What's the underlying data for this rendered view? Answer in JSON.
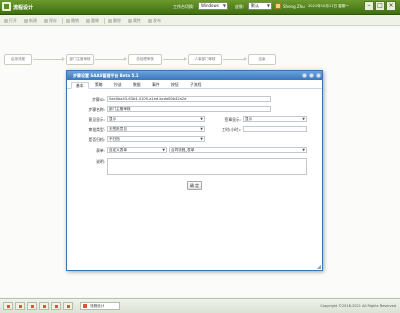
{
  "topbar": {
    "app_title": "流程设计",
    "work_switch_label": "工作台切换:",
    "work_switch_value": "Windows",
    "skin_label": "皮肤:",
    "skin_value": "默认",
    "user_name": "Sheng Zhu",
    "datetime": "2021年10月11日 星期一",
    "colors": {
      "bar_top": "#6c9a2c",
      "bar_bottom": "#3f6e12"
    }
  },
  "toolbar": {
    "items": [
      {
        "label": "打开",
        "icon": "folder-open-icon"
      },
      {
        "label": "新建",
        "icon": "new-file-icon"
      },
      {
        "label": "保存",
        "icon": "save-icon"
      },
      {
        "label": "撤销",
        "icon": "undo-icon"
      },
      {
        "label": "重做",
        "icon": "redo-icon"
      },
      {
        "label": "删除",
        "icon": "delete-icon"
      },
      {
        "label": "属性",
        "icon": "properties-icon"
      },
      {
        "label": "发布",
        "icon": "publish-icon"
      }
    ]
  },
  "flow": {
    "nodes": [
      {
        "label": "启用流程"
      },
      {
        "label": "部门主管审核"
      },
      {
        "label": "总经理审核"
      },
      {
        "label": "人事部门审核"
      },
      {
        "label": "结束"
      }
    ]
  },
  "modal": {
    "title": "步骤设置 SAAS管理平台 Beta 5.1",
    "tabs": [
      "基本",
      "策略",
      "抄送",
      "数据",
      "事件",
      "按钮",
      "子流程"
    ],
    "active_tab": "基本",
    "fields": {
      "step_id_label": "步骤ID:",
      "step_id_value": "0ae0ba43-63b4-4109-a1ed-bcda80b42a2d",
      "step_name_label": "步骤名称:",
      "step_name_value": "部门主管审核",
      "opinion_label": "意见显示:",
      "opinion_value": "显示",
      "signature_label": "签章显示:",
      "signature_value": "显示",
      "approval_type_label": "审批类型:",
      "approval_type_value": "无签批意见",
      "work_hours_label": "工时(小时):",
      "work_hours_value": "",
      "archive_label": "是否归档:",
      "archive_value": "不归档",
      "form_label": "表单:",
      "form_value": "自定义表单",
      "form_value2": "合同流程_表单",
      "remark_label": "说明:",
      "remark_value": ""
    },
    "ok_label": "确 定",
    "colors": {
      "header_top": "#6aa3dc",
      "header_bottom": "#3a77bd"
    }
  },
  "statusbar": {
    "open_tab_label": "流程设计",
    "copyright": "Copyright ©2018-2021 All Rights Reserved"
  }
}
